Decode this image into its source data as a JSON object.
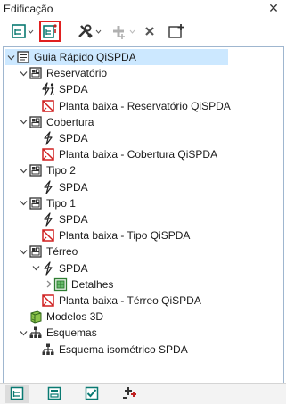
{
  "panel": {
    "title": "Edificação"
  },
  "colors": {
    "selection": "#cce8ff",
    "accent_red": "#e02020",
    "icon_teal": "#0a7a72",
    "tree_border": "#9fb6cf"
  },
  "toolbar": {
    "buttons": [
      {
        "name": "building-tree-icon",
        "dropdown": true
      },
      {
        "name": "edit-building-icon",
        "highlighted": true
      },
      {
        "name": "tools-icon",
        "dropdown": true
      },
      {
        "name": "add-element-icon",
        "dropdown": true,
        "disabled": true
      },
      {
        "name": "delete-icon"
      },
      {
        "name": "new-window-icon"
      }
    ]
  },
  "tree": {
    "root": "Guia Rápido QiSPDA",
    "levels": [
      {
        "name": "Reservatório",
        "spda": "SPDA",
        "plan": "Planta baixa - Reservatório QiSPDA"
      },
      {
        "name": "Cobertura",
        "spda": "SPDA",
        "plan": "Planta baixa - Cobertura QiSPDA"
      },
      {
        "name": "Tipo 2",
        "spda": "SPDA"
      },
      {
        "name": "Tipo 1",
        "spda": "SPDA",
        "plan": "Planta baixa - Tipo QiSPDA"
      },
      {
        "name": "Térreo",
        "spda": "SPDA",
        "details": "Detalhes",
        "plan": "Planta baixa - Térreo QiSPDA"
      }
    ],
    "models": "Modelos 3D",
    "schemes": "Esquemas",
    "scheme_item": "Esquema isométrico SPDA"
  },
  "bottom_tabs": [
    {
      "name": "tab-building-icon",
      "active": true
    },
    {
      "name": "tab-structure-icon",
      "active": false
    },
    {
      "name": "tab-check-icon",
      "active": false
    },
    {
      "name": "tab-plugins-icon",
      "active": false
    }
  ]
}
